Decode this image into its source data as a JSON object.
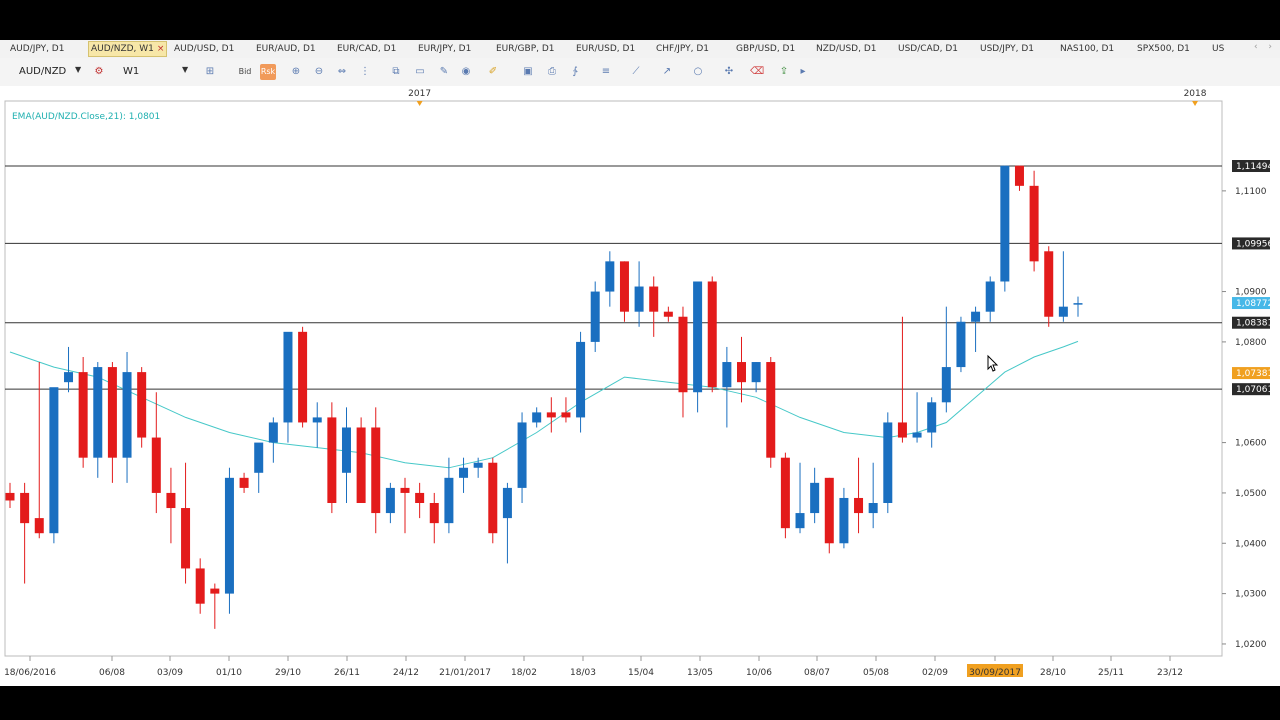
{
  "tabs": [
    {
      "label": "AUD/JPY, D1",
      "active": false
    },
    {
      "label": "AUD/NZD, W1",
      "active": true,
      "close": "×"
    },
    {
      "label": "AUD/USD, D1",
      "active": false
    },
    {
      "label": "EUR/AUD, D1",
      "active": false
    },
    {
      "label": "EUR/CAD, D1",
      "active": false
    },
    {
      "label": "EUR/JPY, D1",
      "active": false
    },
    {
      "label": "EUR/GBP, D1",
      "active": false
    },
    {
      "label": "EUR/USD, D1",
      "active": false
    },
    {
      "label": "CHF/JPY, D1",
      "active": false
    },
    {
      "label": "GBP/USD, D1",
      "active": false
    },
    {
      "label": "NZD/USD, D1",
      "active": false
    },
    {
      "label": "USD/CAD, D1",
      "active": false
    },
    {
      "label": "USD/JPY, D1",
      "active": false
    },
    {
      "label": "NAS100, D1",
      "active": false
    },
    {
      "label": "SPX500, D1",
      "active": false
    },
    {
      "label": "US",
      "active": false
    }
  ],
  "toolbar": {
    "symbol": "AUD/NZD",
    "timeframe": "W1",
    "bid_label": "Bid",
    "risk_label": "Rsk",
    "icons": [
      "crosshair-icon",
      "zoom-in-icon",
      "zoom-out-icon",
      "zoom-fit-icon",
      "period-separator-icon",
      "copy-icon",
      "chart-type-icon",
      "globe-icon",
      "pencil-icon",
      "screenshot-icon",
      "print-icon",
      "indicators-icon",
      "list-icon",
      "line-tool-icon",
      "trend-tool-icon",
      "shape-tool-icon",
      "crosshair-tool-icon",
      "eraser-icon",
      "export-icon",
      "more-icon"
    ]
  },
  "indicator": {
    "label": "EMA(AUD/NZD.Close,21): 1,0801",
    "color": "#20b0b0"
  },
  "colors": {
    "bull": "#1a6fc0",
    "bear": "#e31b1b",
    "ema": "#46c8c8",
    "hline": "#333333",
    "price_tag_blue": "#46b8e8",
    "price_tag_orange": "#f0a020",
    "price_tag_dark": "#2a2a2a",
    "date_highlight": "#f0a020"
  },
  "chart_data": {
    "type": "candlestick",
    "symbol": "AUD/NZD",
    "timeframe": "W1",
    "ylim": [
      1.0188,
      1.1209
    ],
    "y_ticks": [
      "1,1100",
      "1,0900",
      "1,0800",
      "1,0600",
      "1,0500",
      "1,0400",
      "1,0300",
      "1,0200"
    ],
    "x_ticks": [
      "18/06/2016",
      "06/08",
      "03/09",
      "01/10",
      "29/10",
      "26/11",
      "24/12",
      "21/01/2017",
      "18/02",
      "18/03",
      "15/04",
      "13/05",
      "10/06",
      "08/07",
      "05/08",
      "02/09",
      "30/09/2017",
      "28/10",
      "25/11",
      "23/12"
    ],
    "x_tick_highlight": "30/09/2017",
    "year_markers": [
      {
        "label": "2017",
        "after_week": 28
      },
      {
        "label": "2018",
        "after_week": 81
      }
    ],
    "horizontal_lines": [
      1.11494,
      1.09956,
      1.08381,
      1.07061
    ],
    "price_tags": [
      {
        "label": "1,11494",
        "price": 1.11494,
        "style": "dark"
      },
      {
        "label": "1,09956",
        "price": 1.09956,
        "style": "dark"
      },
      {
        "label": "1,08772",
        "price": 1.08772,
        "style": "blue"
      },
      {
        "label": "1,08381",
        "price": 1.08381,
        "style": "dark"
      },
      {
        "label": "1,07381",
        "price": 1.07381,
        "style": "orange"
      },
      {
        "label": "1,07061",
        "price": 1.07061,
        "style": "dark"
      }
    ],
    "candles": [
      {
        "o": 1.05,
        "h": 1.052,
        "l": 1.047,
        "c": 1.0485
      },
      {
        "o": 1.05,
        "h": 1.052,
        "l": 1.032,
        "c": 1.044
      },
      {
        "o": 1.045,
        "h": 1.076,
        "l": 1.041,
        "c": 1.042
      },
      {
        "o": 1.042,
        "h": 1.062,
        "l": 1.04,
        "c": 1.071
      },
      {
        "o": 1.072,
        "h": 1.079,
        "l": 1.07,
        "c": 1.074
      },
      {
        "o": 1.074,
        "h": 1.077,
        "l": 1.055,
        "c": 1.057
      },
      {
        "o": 1.057,
        "h": 1.076,
        "l": 1.053,
        "c": 1.075
      },
      {
        "o": 1.075,
        "h": 1.076,
        "l": 1.052,
        "c": 1.057
      },
      {
        "o": 1.057,
        "h": 1.078,
        "l": 1.052,
        "c": 1.074
      },
      {
        "o": 1.074,
        "h": 1.075,
        "l": 1.059,
        "c": 1.061
      },
      {
        "o": 1.061,
        "h": 1.07,
        "l": 1.046,
        "c": 1.05
      },
      {
        "o": 1.05,
        "h": 1.055,
        "l": 1.04,
        "c": 1.047
      },
      {
        "o": 1.047,
        "h": 1.056,
        "l": 1.032,
        "c": 1.035
      },
      {
        "o": 1.035,
        "h": 1.037,
        "l": 1.026,
        "c": 1.028
      },
      {
        "o": 1.031,
        "h": 1.032,
        "l": 1.023,
        "c": 1.03
      },
      {
        "o": 1.03,
        "h": 1.055,
        "l": 1.026,
        "c": 1.053
      },
      {
        "o": 1.053,
        "h": 1.054,
        "l": 1.05,
        "c": 1.051
      },
      {
        "o": 1.054,
        "h": 1.057,
        "l": 1.05,
        "c": 1.06
      },
      {
        "o": 1.06,
        "h": 1.065,
        "l": 1.056,
        "c": 1.064
      },
      {
        "o": 1.064,
        "h": 1.081,
        "l": 1.06,
        "c": 1.082
      },
      {
        "o": 1.082,
        "h": 1.083,
        "l": 1.063,
        "c": 1.064
      },
      {
        "o": 1.064,
        "h": 1.068,
        "l": 1.059,
        "c": 1.065
      },
      {
        "o": 1.065,
        "h": 1.068,
        "l": 1.046,
        "c": 1.048
      },
      {
        "o": 1.054,
        "h": 1.067,
        "l": 1.048,
        "c": 1.063
      },
      {
        "o": 1.063,
        "h": 1.065,
        "l": 1.049,
        "c": 1.048
      },
      {
        "o": 1.063,
        "h": 1.067,
        "l": 1.042,
        "c": 1.046
      },
      {
        "o": 1.046,
        "h": 1.052,
        "l": 1.044,
        "c": 1.051
      },
      {
        "o": 1.051,
        "h": 1.053,
        "l": 1.042,
        "c": 1.05
      },
      {
        "o": 1.05,
        "h": 1.052,
        "l": 1.045,
        "c": 1.048
      },
      {
        "o": 1.048,
        "h": 1.05,
        "l": 1.04,
        "c": 1.044
      },
      {
        "o": 1.044,
        "h": 1.057,
        "l": 1.042,
        "c": 1.053
      },
      {
        "o": 1.053,
        "h": 1.057,
        "l": 1.05,
        "c": 1.055
      },
      {
        "o": 1.055,
        "h": 1.057,
        "l": 1.053,
        "c": 1.056
      },
      {
        "o": 1.056,
        "h": 1.057,
        "l": 1.04,
        "c": 1.042
      },
      {
        "o": 1.045,
        "h": 1.052,
        "l": 1.036,
        "c": 1.051
      },
      {
        "o": 1.051,
        "h": 1.066,
        "l": 1.048,
        "c": 1.064
      },
      {
        "o": 1.064,
        "h": 1.067,
        "l": 1.063,
        "c": 1.066
      },
      {
        "o": 1.066,
        "h": 1.069,
        "l": 1.062,
        "c": 1.065
      },
      {
        "o": 1.066,
        "h": 1.069,
        "l": 1.064,
        "c": 1.065
      },
      {
        "o": 1.065,
        "h": 1.082,
        "l": 1.062,
        "c": 1.08
      },
      {
        "o": 1.08,
        "h": 1.092,
        "l": 1.078,
        "c": 1.09
      },
      {
        "o": 1.09,
        "h": 1.098,
        "l": 1.087,
        "c": 1.096
      },
      {
        "o": 1.096,
        "h": 1.096,
        "l": 1.084,
        "c": 1.086
      },
      {
        "o": 1.086,
        "h": 1.096,
        "l": 1.083,
        "c": 1.091
      },
      {
        "o": 1.091,
        "h": 1.093,
        "l": 1.081,
        "c": 1.086
      },
      {
        "o": 1.086,
        "h": 1.087,
        "l": 1.084,
        "c": 1.085
      },
      {
        "o": 1.085,
        "h": 1.087,
        "l": 1.065,
        "c": 1.07
      },
      {
        "o": 1.07,
        "h": 1.089,
        "l": 1.066,
        "c": 1.092
      },
      {
        "o": 1.092,
        "h": 1.093,
        "l": 1.07,
        "c": 1.071
      },
      {
        "o": 1.071,
        "h": 1.079,
        "l": 1.063,
        "c": 1.076
      },
      {
        "o": 1.076,
        "h": 1.081,
        "l": 1.068,
        "c": 1.072
      },
      {
        "o": 1.072,
        "h": 1.076,
        "l": 1.07,
        "c": 1.076
      },
      {
        "o": 1.076,
        "h": 1.077,
        "l": 1.055,
        "c": 1.057
      },
      {
        "o": 1.057,
        "h": 1.058,
        "l": 1.041,
        "c": 1.043
      },
      {
        "o": 1.043,
        "h": 1.056,
        "l": 1.042,
        "c": 1.046
      },
      {
        "o": 1.046,
        "h": 1.055,
        "l": 1.044,
        "c": 1.052
      },
      {
        "o": 1.053,
        "h": 1.053,
        "l": 1.038,
        "c": 1.04
      },
      {
        "o": 1.04,
        "h": 1.051,
        "l": 1.039,
        "c": 1.049
      },
      {
        "o": 1.049,
        "h": 1.057,
        "l": 1.042,
        "c": 1.046
      },
      {
        "o": 1.046,
        "h": 1.056,
        "l": 1.043,
        "c": 1.048
      },
      {
        "o": 1.048,
        "h": 1.066,
        "l": 1.046,
        "c": 1.064
      },
      {
        "o": 1.064,
        "h": 1.085,
        "l": 1.06,
        "c": 1.061
      },
      {
        "o": 1.061,
        "h": 1.07,
        "l": 1.06,
        "c": 1.062
      },
      {
        "o": 1.062,
        "h": 1.069,
        "l": 1.059,
        "c": 1.068
      },
      {
        "o": 1.068,
        "h": 1.087,
        "l": 1.066,
        "c": 1.075
      },
      {
        "o": 1.075,
        "h": 1.085,
        "l": 1.074,
        "c": 1.084
      },
      {
        "o": 1.084,
        "h": 1.087,
        "l": 1.078,
        "c": 1.086
      },
      {
        "o": 1.086,
        "h": 1.093,
        "l": 1.084,
        "c": 1.092
      },
      {
        "o": 1.092,
        "h": 1.115,
        "l": 1.09,
        "c": 1.115
      },
      {
        "o": 1.115,
        "h": 1.115,
        "l": 1.11,
        "c": 1.111
      },
      {
        "o": 1.111,
        "h": 1.114,
        "l": 1.094,
        "c": 1.096
      },
      {
        "o": 1.098,
        "h": 1.099,
        "l": 1.083,
        "c": 1.085
      },
      {
        "o": 1.085,
        "h": 1.098,
        "l": 1.084,
        "c": 1.087
      },
      {
        "o": 1.0875,
        "h": 1.089,
        "l": 1.085,
        "c": 1.0877
      }
    ],
    "ema": {
      "name": "EMA(AUD/NZD.Close,21)",
      "points": [
        [
          0,
          1.078
        ],
        [
          3,
          1.075
        ],
        [
          6,
          1.073
        ],
        [
          9,
          1.069
        ],
        [
          12,
          1.065
        ],
        [
          15,
          1.062
        ],
        [
          18,
          1.06
        ],
        [
          21,
          1.059
        ],
        [
          24,
          1.058
        ],
        [
          27,
          1.056
        ],
        [
          30,
          1.055
        ],
        [
          33,
          1.057
        ],
        [
          36,
          1.062
        ],
        [
          39,
          1.068
        ],
        [
          42,
          1.073
        ],
        [
          45,
          1.072
        ],
        [
          48,
          1.071
        ],
        [
          51,
          1.069
        ],
        [
          54,
          1.065
        ],
        [
          57,
          1.062
        ],
        [
          60,
          1.061
        ],
        [
          62,
          1.062
        ],
        [
          64,
          1.064
        ],
        [
          66,
          1.069
        ],
        [
          68,
          1.074
        ],
        [
          70,
          1.077
        ],
        [
          72,
          1.079
        ],
        [
          73,
          1.0801
        ]
      ]
    }
  }
}
